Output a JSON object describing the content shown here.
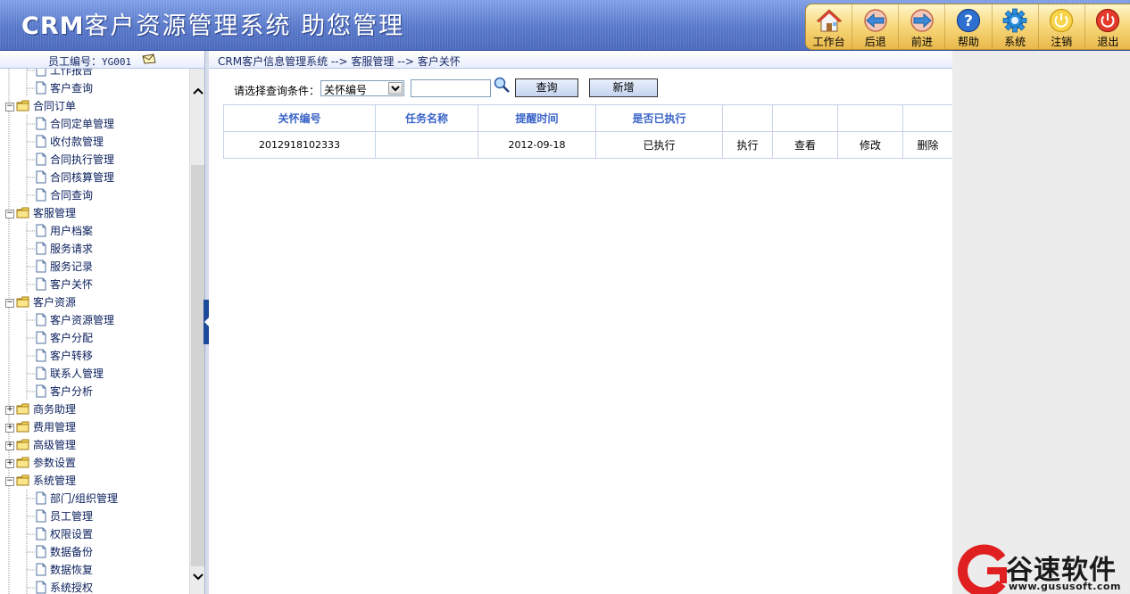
{
  "app": {
    "title_bold": "CRM",
    "title_rest": "客户资源管理系统  助您管理"
  },
  "toolbar": [
    {
      "label": "工作台",
      "icon": "home-icon"
    },
    {
      "label": "后退",
      "icon": "back-arrow-icon"
    },
    {
      "label": "前进",
      "icon": "forward-arrow-icon"
    },
    {
      "label": "帮助",
      "icon": "help-icon"
    },
    {
      "label": "系统",
      "icon": "gear-icon"
    },
    {
      "label": "注销",
      "icon": "power-icon"
    },
    {
      "label": "退出",
      "icon": "exit-icon"
    }
  ],
  "user": {
    "label": "员工编号：",
    "id": "YG001"
  },
  "breadcrumb": "CRM客户信息管理系统 --> 客服管理 --> 客户关怀",
  "tree": [
    {
      "type": "leaf",
      "label": "工作报告",
      "clipped": true
    },
    {
      "type": "leaf",
      "label": "客户查询"
    },
    {
      "type": "folder",
      "label": "合同订单",
      "expanded": true
    },
    {
      "type": "leaf",
      "label": "合同定单管理"
    },
    {
      "type": "leaf",
      "label": "收付款管理"
    },
    {
      "type": "leaf",
      "label": "合同执行管理"
    },
    {
      "type": "leaf",
      "label": "合同核算管理"
    },
    {
      "type": "leaf",
      "label": "合同查询"
    },
    {
      "type": "folder",
      "label": "客服管理",
      "expanded": true
    },
    {
      "type": "leaf",
      "label": "用户档案"
    },
    {
      "type": "leaf",
      "label": "服务请求"
    },
    {
      "type": "leaf",
      "label": "服务记录"
    },
    {
      "type": "leaf",
      "label": "客户关怀"
    },
    {
      "type": "folder",
      "label": "客户资源",
      "expanded": true
    },
    {
      "type": "leaf",
      "label": "客户资源管理"
    },
    {
      "type": "leaf",
      "label": "客户分配"
    },
    {
      "type": "leaf",
      "label": "客户转移"
    },
    {
      "type": "leaf",
      "label": "联系人管理"
    },
    {
      "type": "leaf",
      "label": "客户分析"
    },
    {
      "type": "folder",
      "label": "商务助理",
      "expanded": false
    },
    {
      "type": "folder",
      "label": "费用管理",
      "expanded": false
    },
    {
      "type": "folder",
      "label": "高级管理",
      "expanded": false
    },
    {
      "type": "folder",
      "label": "参数设置",
      "expanded": false
    },
    {
      "type": "folder",
      "label": "系统管理",
      "expanded": true
    },
    {
      "type": "leaf",
      "label": "部门/组织管理"
    },
    {
      "type": "leaf",
      "label": "员工管理"
    },
    {
      "type": "leaf",
      "label": "权限设置"
    },
    {
      "type": "leaf",
      "label": "数据备份"
    },
    {
      "type": "leaf",
      "label": "数据恢复"
    },
    {
      "type": "leaf",
      "label": "系统授权"
    }
  ],
  "query": {
    "label": "请选择查询条件：",
    "select_value": "关怀编号",
    "input_value": "",
    "search_button": "查询",
    "add_button": "新增"
  },
  "grid": {
    "headers": [
      "关怀编号",
      "任务名称",
      "提醒时间",
      "是否已执行",
      "",
      "",
      "",
      ""
    ],
    "rows": [
      {
        "id": "2012918102333",
        "task": "",
        "remind_time": "2012-09-18",
        "executed": "已执行",
        "action_execute": "执行",
        "action_view": "查看",
        "action_edit": "修改",
        "action_delete": "删除"
      }
    ]
  },
  "watermark": {
    "text": "谷速软件",
    "url": "www.gususoft.com"
  },
  "colors": {
    "header_blue": "#5c7fd0",
    "toolbar_gold": "#f7d77a",
    "grid_header_text": "#3a64c8",
    "tree_text": "#0a1f5c",
    "watermark_red": "#e02020"
  }
}
